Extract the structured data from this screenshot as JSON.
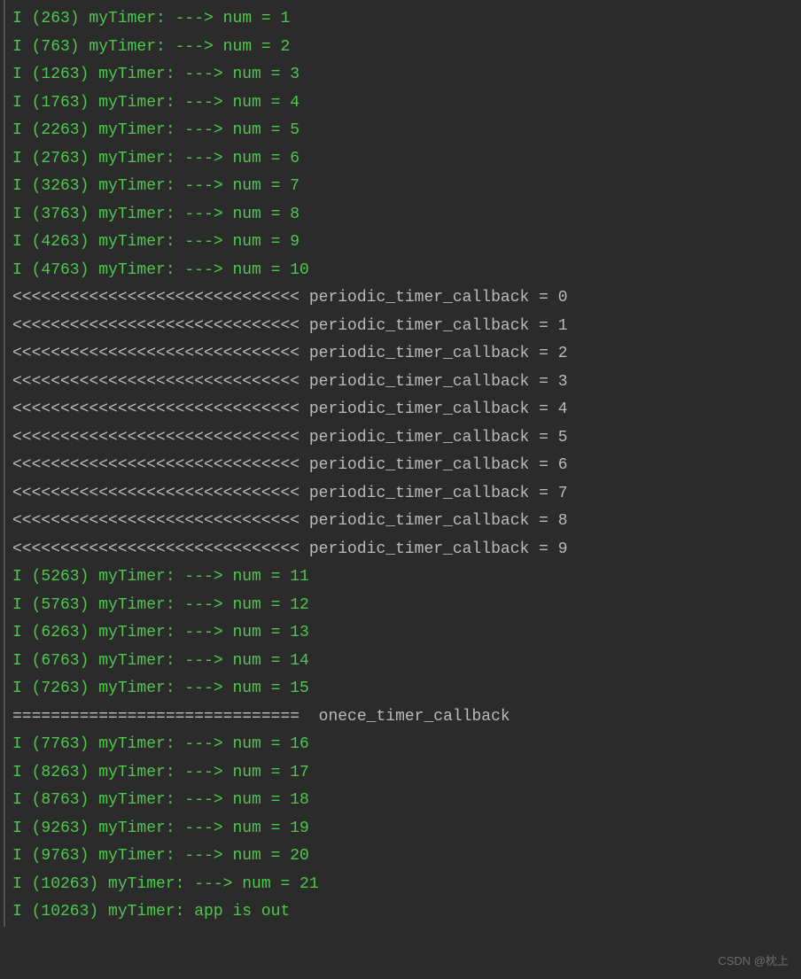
{
  "lines": [
    {
      "type": "green",
      "text": "I (263) myTimer: ---> num = 1"
    },
    {
      "type": "green",
      "text": "I (763) myTimer: ---> num = 2"
    },
    {
      "type": "green",
      "text": "I (1263) myTimer: ---> num = 3"
    },
    {
      "type": "green",
      "text": "I (1763) myTimer: ---> num = 4"
    },
    {
      "type": "green",
      "text": "I (2263) myTimer: ---> num = 5"
    },
    {
      "type": "green",
      "text": "I (2763) myTimer: ---> num = 6"
    },
    {
      "type": "green",
      "text": "I (3263) myTimer: ---> num = 7"
    },
    {
      "type": "green",
      "text": "I (3763) myTimer: ---> num = 8"
    },
    {
      "type": "green",
      "text": "I (4263) myTimer: ---> num = 9"
    },
    {
      "type": "green",
      "text": "I (4763) myTimer: ---> num = 10"
    },
    {
      "type": "gray",
      "text": "<<<<<<<<<<<<<<<<<<<<<<<<<<<<<< periodic_timer_callback = 0"
    },
    {
      "type": "gray",
      "text": "<<<<<<<<<<<<<<<<<<<<<<<<<<<<<< periodic_timer_callback = 1"
    },
    {
      "type": "gray",
      "text": "<<<<<<<<<<<<<<<<<<<<<<<<<<<<<< periodic_timer_callback = 2"
    },
    {
      "type": "gray",
      "text": "<<<<<<<<<<<<<<<<<<<<<<<<<<<<<< periodic_timer_callback = 3"
    },
    {
      "type": "gray",
      "text": "<<<<<<<<<<<<<<<<<<<<<<<<<<<<<< periodic_timer_callback = 4"
    },
    {
      "type": "gray",
      "text": "<<<<<<<<<<<<<<<<<<<<<<<<<<<<<< periodic_timer_callback = 5"
    },
    {
      "type": "gray",
      "text": "<<<<<<<<<<<<<<<<<<<<<<<<<<<<<< periodic_timer_callback = 6"
    },
    {
      "type": "gray",
      "text": "<<<<<<<<<<<<<<<<<<<<<<<<<<<<<< periodic_timer_callback = 7"
    },
    {
      "type": "gray",
      "text": "<<<<<<<<<<<<<<<<<<<<<<<<<<<<<< periodic_timer_callback = 8"
    },
    {
      "type": "gray",
      "text": "<<<<<<<<<<<<<<<<<<<<<<<<<<<<<< periodic_timer_callback = 9"
    },
    {
      "type": "green",
      "text": "I (5263) myTimer: ---> num = 11"
    },
    {
      "type": "green",
      "text": "I (5763) myTimer: ---> num = 12"
    },
    {
      "type": "green",
      "text": "I (6263) myTimer: ---> num = 13"
    },
    {
      "type": "green",
      "text": "I (6763) myTimer: ---> num = 14"
    },
    {
      "type": "green",
      "text": "I (7263) myTimer: ---> num = 15"
    },
    {
      "type": "gray",
      "text": "==============================  onece_timer_callback"
    },
    {
      "type": "green",
      "text": "I (7763) myTimer: ---> num = 16"
    },
    {
      "type": "green",
      "text": "I (8263) myTimer: ---> num = 17"
    },
    {
      "type": "green",
      "text": "I (8763) myTimer: ---> num = 18"
    },
    {
      "type": "green",
      "text": "I (9263) myTimer: ---> num = 19"
    },
    {
      "type": "green",
      "text": "I (9763) myTimer: ---> num = 20"
    },
    {
      "type": "green",
      "text": "I (10263) myTimer: ---> num = 21"
    },
    {
      "type": "green",
      "text": "I (10263) myTimer: app is out"
    }
  ],
  "watermark": "CSDN @枕上"
}
